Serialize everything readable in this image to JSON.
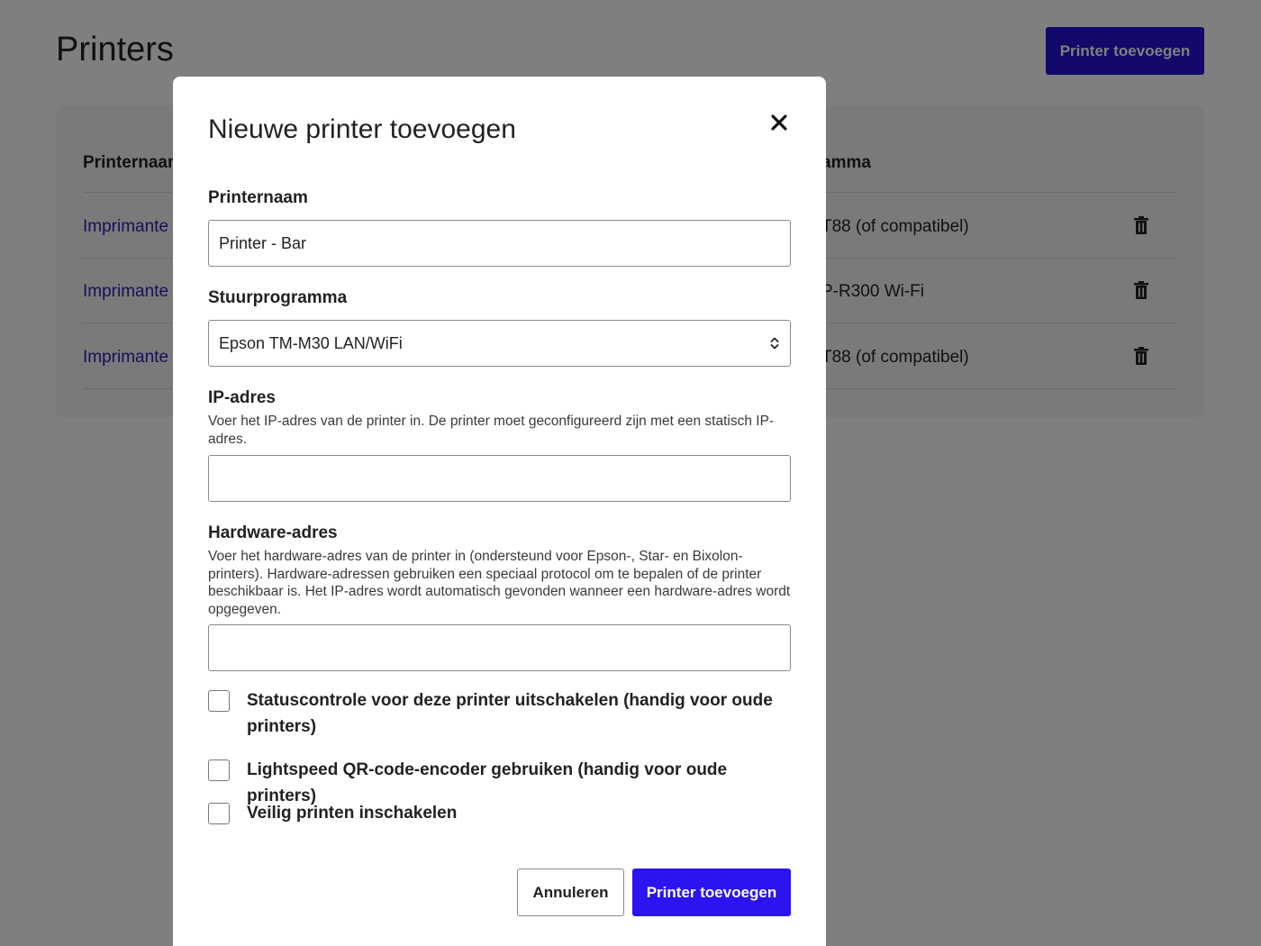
{
  "page": {
    "title": "Printers",
    "add_button_label": "Printer toevoegen",
    "table": {
      "headers": {
        "name": "Printernaam",
        "driver": "amma"
      },
      "rows": [
        {
          "name": "Imprimante",
          "driver": "T88 (of compatibel)"
        },
        {
          "name": "Imprimante",
          "driver": "P-R300 Wi-Fi"
        },
        {
          "name": "Imprimante",
          "driver": "T88 (of compatibel)"
        }
      ],
      "delete_icon": "trash-icon"
    }
  },
  "modal": {
    "title": "Nieuwe printer toevoegen",
    "close_icon": "close-icon",
    "printer_name": {
      "label": "Printernaam",
      "value": "Printer - Bar"
    },
    "driver": {
      "label": "Stuurprogramma",
      "value": "Epson TM-M30 LAN/WiFi"
    },
    "ip": {
      "label": "IP-adres",
      "help": "Voer het IP-adres van de printer in. De printer moet geconfigureerd zijn met een statisch IP-adres.",
      "value": ""
    },
    "hardware": {
      "label": "Hardware-adres",
      "help": "Voer het hardware-adres van de printer in (ondersteund voor Epson-, Star- en Bixolon-printers). Hardware-adressen gebruiken een speciaal protocol om te bepalen of de printer beschikbaar is. Het IP-adres wordt automatisch gevonden wanneer een hardware-adres wordt opgegeven.",
      "value": ""
    },
    "checkboxes": [
      {
        "label": "Statuscontrole voor deze printer uitschakelen (handig voor oude printers)",
        "checked": false
      },
      {
        "label": "Lightspeed QR-code-encoder gebruiken (handig voor oude printers)",
        "checked": false
      },
      {
        "label": "Veilig printen inschakelen",
        "checked": false
      }
    ],
    "cancel_label": "Annuleren",
    "submit_label": "Printer toevoegen"
  },
  "colors": {
    "accent": "#2b14f0",
    "link": "#2a1fb8"
  }
}
